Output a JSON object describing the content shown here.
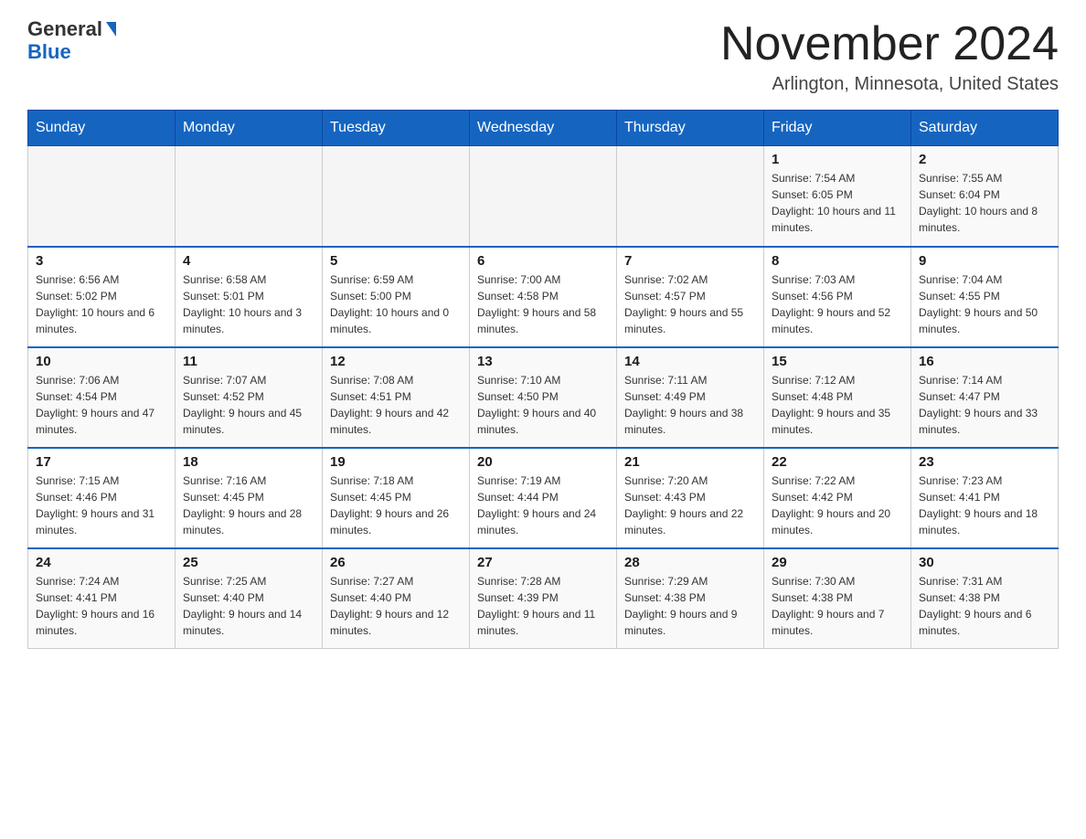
{
  "header": {
    "logo_line1": "General",
    "logo_line2": "Blue",
    "title": "November 2024",
    "subtitle": "Arlington, Minnesota, United States"
  },
  "days_of_week": [
    "Sunday",
    "Monday",
    "Tuesday",
    "Wednesday",
    "Thursday",
    "Friday",
    "Saturday"
  ],
  "weeks": [
    [
      {
        "day": "",
        "sunrise": "",
        "sunset": "",
        "daylight": ""
      },
      {
        "day": "",
        "sunrise": "",
        "sunset": "",
        "daylight": ""
      },
      {
        "day": "",
        "sunrise": "",
        "sunset": "",
        "daylight": ""
      },
      {
        "day": "",
        "sunrise": "",
        "sunset": "",
        "daylight": ""
      },
      {
        "day": "",
        "sunrise": "",
        "sunset": "",
        "daylight": ""
      },
      {
        "day": "1",
        "sunrise": "Sunrise: 7:54 AM",
        "sunset": "Sunset: 6:05 PM",
        "daylight": "Daylight: 10 hours and 11 minutes."
      },
      {
        "day": "2",
        "sunrise": "Sunrise: 7:55 AM",
        "sunset": "Sunset: 6:04 PM",
        "daylight": "Daylight: 10 hours and 8 minutes."
      }
    ],
    [
      {
        "day": "3",
        "sunrise": "Sunrise: 6:56 AM",
        "sunset": "Sunset: 5:02 PM",
        "daylight": "Daylight: 10 hours and 6 minutes."
      },
      {
        "day": "4",
        "sunrise": "Sunrise: 6:58 AM",
        "sunset": "Sunset: 5:01 PM",
        "daylight": "Daylight: 10 hours and 3 minutes."
      },
      {
        "day": "5",
        "sunrise": "Sunrise: 6:59 AM",
        "sunset": "Sunset: 5:00 PM",
        "daylight": "Daylight: 10 hours and 0 minutes."
      },
      {
        "day": "6",
        "sunrise": "Sunrise: 7:00 AM",
        "sunset": "Sunset: 4:58 PM",
        "daylight": "Daylight: 9 hours and 58 minutes."
      },
      {
        "day": "7",
        "sunrise": "Sunrise: 7:02 AM",
        "sunset": "Sunset: 4:57 PM",
        "daylight": "Daylight: 9 hours and 55 minutes."
      },
      {
        "day": "8",
        "sunrise": "Sunrise: 7:03 AM",
        "sunset": "Sunset: 4:56 PM",
        "daylight": "Daylight: 9 hours and 52 minutes."
      },
      {
        "day": "9",
        "sunrise": "Sunrise: 7:04 AM",
        "sunset": "Sunset: 4:55 PM",
        "daylight": "Daylight: 9 hours and 50 minutes."
      }
    ],
    [
      {
        "day": "10",
        "sunrise": "Sunrise: 7:06 AM",
        "sunset": "Sunset: 4:54 PM",
        "daylight": "Daylight: 9 hours and 47 minutes."
      },
      {
        "day": "11",
        "sunrise": "Sunrise: 7:07 AM",
        "sunset": "Sunset: 4:52 PM",
        "daylight": "Daylight: 9 hours and 45 minutes."
      },
      {
        "day": "12",
        "sunrise": "Sunrise: 7:08 AM",
        "sunset": "Sunset: 4:51 PM",
        "daylight": "Daylight: 9 hours and 42 minutes."
      },
      {
        "day": "13",
        "sunrise": "Sunrise: 7:10 AM",
        "sunset": "Sunset: 4:50 PM",
        "daylight": "Daylight: 9 hours and 40 minutes."
      },
      {
        "day": "14",
        "sunrise": "Sunrise: 7:11 AM",
        "sunset": "Sunset: 4:49 PM",
        "daylight": "Daylight: 9 hours and 38 minutes."
      },
      {
        "day": "15",
        "sunrise": "Sunrise: 7:12 AM",
        "sunset": "Sunset: 4:48 PM",
        "daylight": "Daylight: 9 hours and 35 minutes."
      },
      {
        "day": "16",
        "sunrise": "Sunrise: 7:14 AM",
        "sunset": "Sunset: 4:47 PM",
        "daylight": "Daylight: 9 hours and 33 minutes."
      }
    ],
    [
      {
        "day": "17",
        "sunrise": "Sunrise: 7:15 AM",
        "sunset": "Sunset: 4:46 PM",
        "daylight": "Daylight: 9 hours and 31 minutes."
      },
      {
        "day": "18",
        "sunrise": "Sunrise: 7:16 AM",
        "sunset": "Sunset: 4:45 PM",
        "daylight": "Daylight: 9 hours and 28 minutes."
      },
      {
        "day": "19",
        "sunrise": "Sunrise: 7:18 AM",
        "sunset": "Sunset: 4:45 PM",
        "daylight": "Daylight: 9 hours and 26 minutes."
      },
      {
        "day": "20",
        "sunrise": "Sunrise: 7:19 AM",
        "sunset": "Sunset: 4:44 PM",
        "daylight": "Daylight: 9 hours and 24 minutes."
      },
      {
        "day": "21",
        "sunrise": "Sunrise: 7:20 AM",
        "sunset": "Sunset: 4:43 PM",
        "daylight": "Daylight: 9 hours and 22 minutes."
      },
      {
        "day": "22",
        "sunrise": "Sunrise: 7:22 AM",
        "sunset": "Sunset: 4:42 PM",
        "daylight": "Daylight: 9 hours and 20 minutes."
      },
      {
        "day": "23",
        "sunrise": "Sunrise: 7:23 AM",
        "sunset": "Sunset: 4:41 PM",
        "daylight": "Daylight: 9 hours and 18 minutes."
      }
    ],
    [
      {
        "day": "24",
        "sunrise": "Sunrise: 7:24 AM",
        "sunset": "Sunset: 4:41 PM",
        "daylight": "Daylight: 9 hours and 16 minutes."
      },
      {
        "day": "25",
        "sunrise": "Sunrise: 7:25 AM",
        "sunset": "Sunset: 4:40 PM",
        "daylight": "Daylight: 9 hours and 14 minutes."
      },
      {
        "day": "26",
        "sunrise": "Sunrise: 7:27 AM",
        "sunset": "Sunset: 4:40 PM",
        "daylight": "Daylight: 9 hours and 12 minutes."
      },
      {
        "day": "27",
        "sunrise": "Sunrise: 7:28 AM",
        "sunset": "Sunset: 4:39 PM",
        "daylight": "Daylight: 9 hours and 11 minutes."
      },
      {
        "day": "28",
        "sunrise": "Sunrise: 7:29 AM",
        "sunset": "Sunset: 4:38 PM",
        "daylight": "Daylight: 9 hours and 9 minutes."
      },
      {
        "day": "29",
        "sunrise": "Sunrise: 7:30 AM",
        "sunset": "Sunset: 4:38 PM",
        "daylight": "Daylight: 9 hours and 7 minutes."
      },
      {
        "day": "30",
        "sunrise": "Sunrise: 7:31 AM",
        "sunset": "Sunset: 4:38 PM",
        "daylight": "Daylight: 9 hours and 6 minutes."
      }
    ]
  ]
}
